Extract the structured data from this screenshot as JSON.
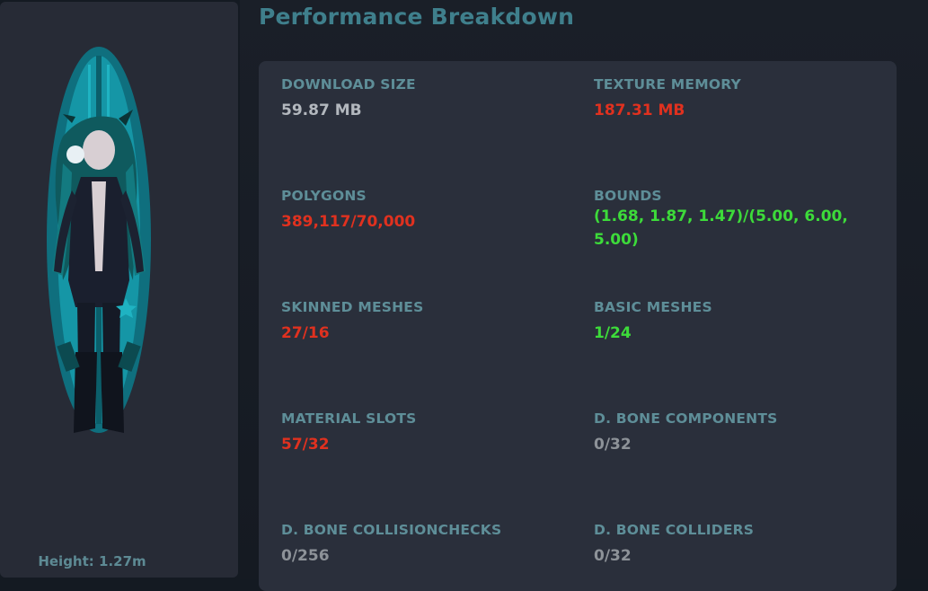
{
  "avatar": {
    "height_label": "Height: 1.27m"
  },
  "header": {
    "title": "Performance Breakdown"
  },
  "stats": [
    {
      "label": "DOWNLOAD SIZE",
      "value": "59.87 MB",
      "status": "neutral"
    },
    {
      "label": "TEXTURE MEMORY",
      "value": "187.31 MB",
      "status": "bad"
    },
    {
      "label": "POLYGONS",
      "value": "389,117/70,000",
      "status": "bad"
    },
    {
      "label": "BOUNDS",
      "value": "(1.68, 1.87, 1.47)/(5.00, 6.00, 5.00)",
      "status": "good"
    },
    {
      "label": "SKINNED MESHES",
      "value": "27/16",
      "status": "bad"
    },
    {
      "label": "BASIC MESHES",
      "value": "1/24",
      "status": "good"
    },
    {
      "label": "MATERIAL SLOTS",
      "value": "57/32",
      "status": "bad"
    },
    {
      "label": "D. BONE COMPONENTS",
      "value": "0/32",
      "status": "neutral"
    },
    {
      "label": "D. BONE COLLISIONCHECKS",
      "value": "0/256",
      "status": "neutral"
    },
    {
      "label": "D. BONE COLLIDERS",
      "value": "0/32",
      "status": "neutral"
    }
  ],
  "colors": {
    "title": "#3f7f8c",
    "label": "#5e8e98",
    "neutral": "#b3b8be",
    "bad": "#e0311f",
    "good": "#3ddb3a"
  }
}
